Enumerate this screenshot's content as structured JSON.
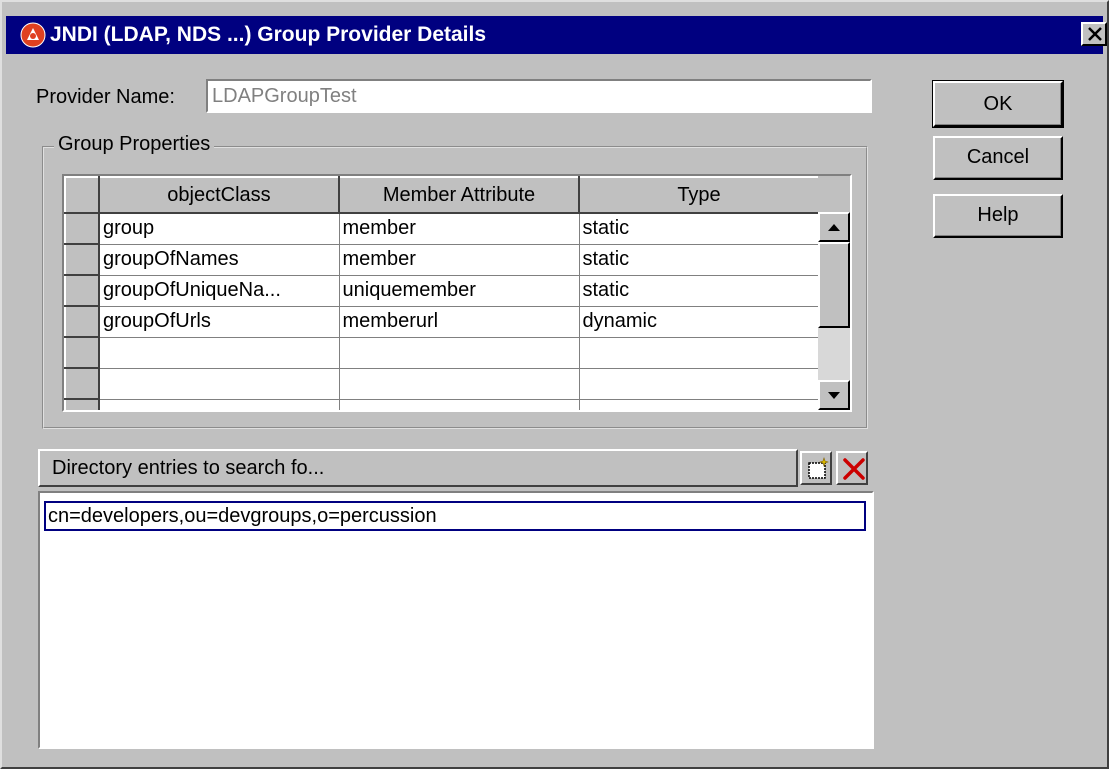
{
  "window": {
    "title": "JNDI (LDAP, NDS ...) Group Provider Details",
    "app_icon": "oracle-logo-icon",
    "close_icon": "close-icon"
  },
  "provider": {
    "label": "Provider Name:",
    "value": "LDAPGroupTest"
  },
  "group_properties": {
    "legend": "Group Properties",
    "columns": [
      "objectClass",
      "Member Attribute",
      "Type"
    ],
    "rows": [
      [
        "group",
        "member",
        "static"
      ],
      [
        "groupOfNames",
        "member",
        "static"
      ],
      [
        "groupOfUniqueNa...",
        "uniquemember",
        "static"
      ],
      [
        "groupOfUrls",
        "memberurl",
        "dynamic"
      ],
      [
        "",
        "",
        ""
      ],
      [
        "",
        "",
        ""
      ],
      [
        "",
        "",
        ""
      ]
    ]
  },
  "directory_entries": {
    "header": "Directory entries to search fo...",
    "add_icon": "new-entry-icon",
    "delete_icon": "delete-x-icon",
    "items": [
      "cn=developers,ou=devgroups,o=percussion"
    ]
  },
  "buttons": {
    "ok": "OK",
    "cancel": "Cancel",
    "help": "Help"
  },
  "colors": {
    "title_bar": "#000080",
    "dialog_bg": "#c0c0c0",
    "delete_icon": "#cc0000"
  }
}
